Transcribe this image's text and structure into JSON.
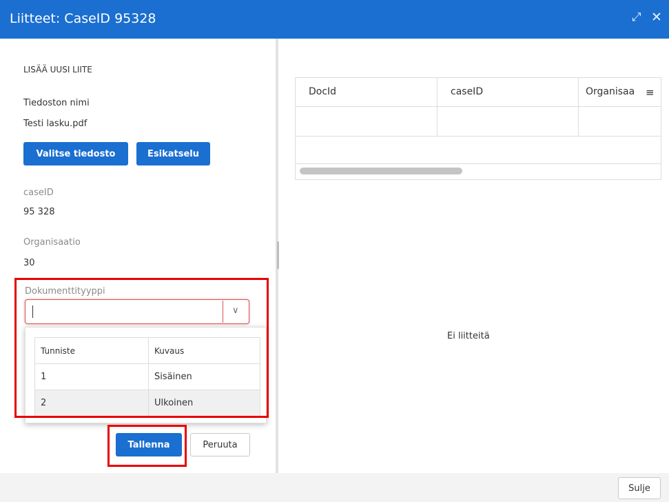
{
  "window": {
    "title": "Liitteet: CaseID 95328",
    "maximize_icon": "expand-icon",
    "close_icon": "close-icon"
  },
  "form": {
    "section_title": "LISÄÄ UUSI LIITE",
    "file_label": "Tiedoston nimi",
    "file_value": "Testi lasku.pdf",
    "choose_file_label": "Valitse tiedosto",
    "preview_label": "Esikatselu",
    "caseid_label": "caseID",
    "caseid_value": "95 328",
    "org_label": "Organisaatio",
    "org_value": "30",
    "doctype_label": "Dokumenttityyppi",
    "doctype_value": "",
    "save_label": "Tallenna",
    "cancel_label": "Peruuta"
  },
  "dropdown": {
    "columns": [
      "Tunniste",
      "Kuvaus"
    ],
    "rows": [
      {
        "id": "1",
        "desc": "Sisäinen"
      },
      {
        "id": "2",
        "desc": "Ulkoinen"
      }
    ]
  },
  "grid": {
    "columns": [
      "DocId",
      "caseID",
      "Organisaa"
    ],
    "empty_text": "Ei liitteitä"
  },
  "footer": {
    "close_label": "Sulje"
  },
  "colors": {
    "header_blue": "#1a6fd0",
    "highlight_red": "#e60000"
  }
}
